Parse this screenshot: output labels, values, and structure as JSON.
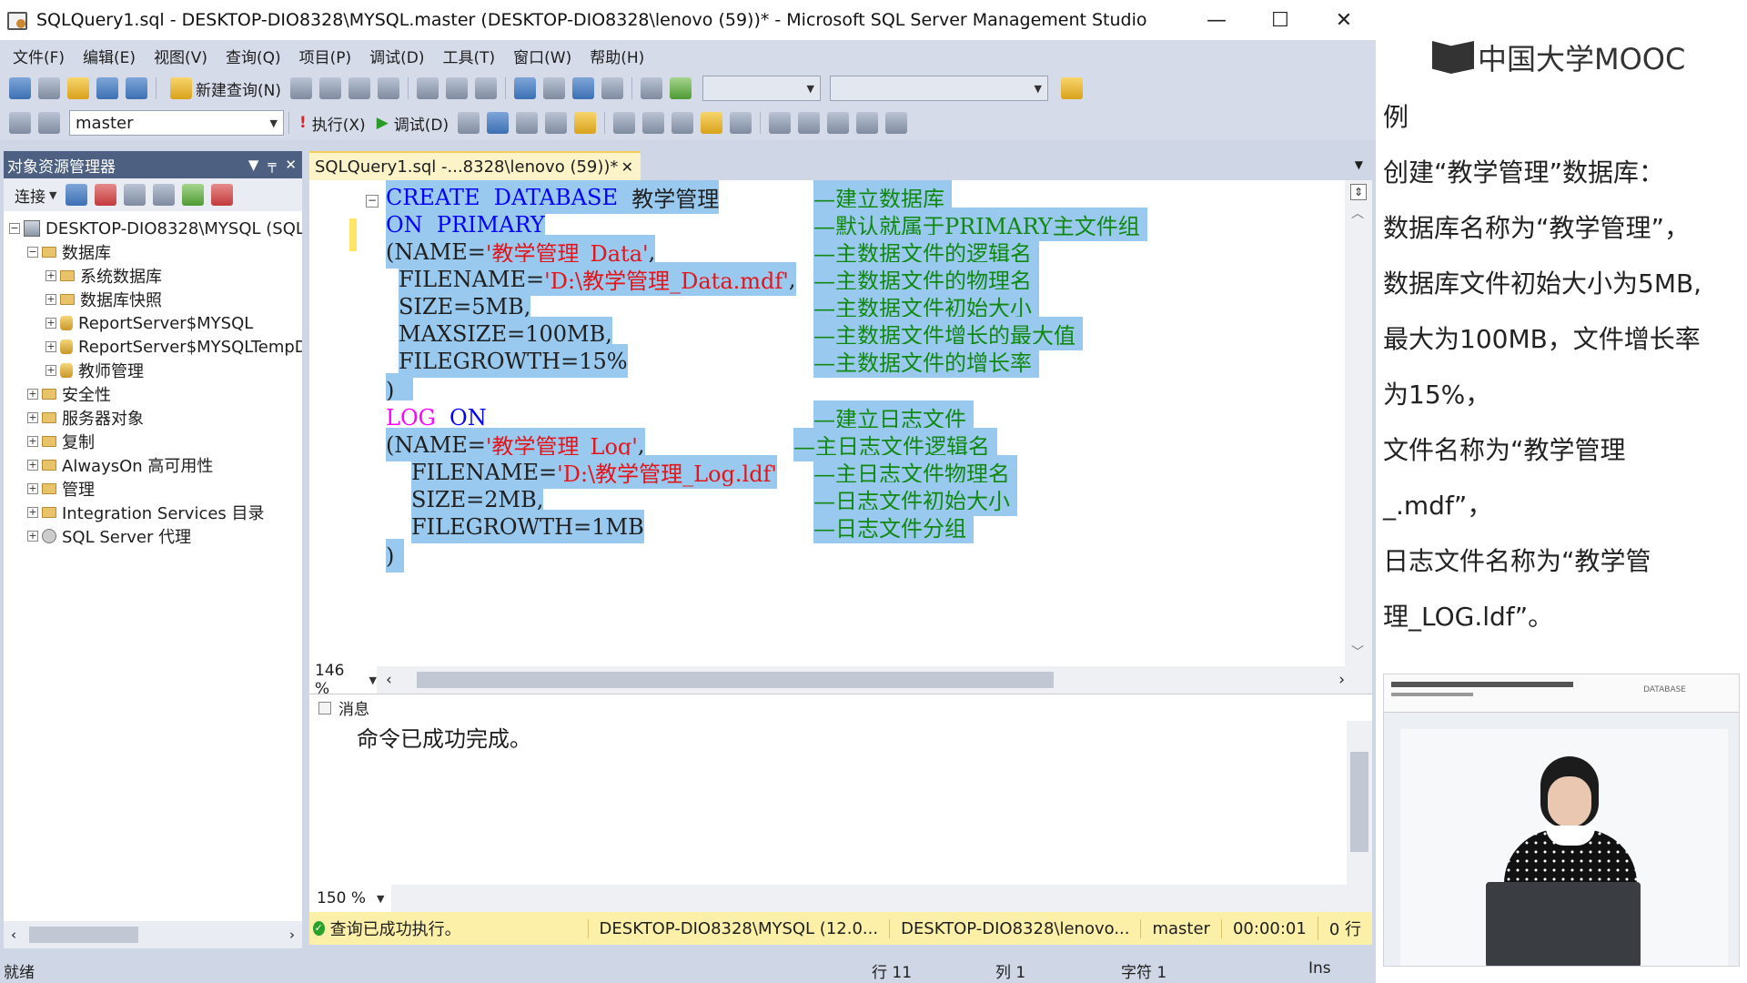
{
  "window": {
    "title": "SQLQuery1.sql - DESKTOP-DIO8328\\MYSQL.master (DESKTOP-DIO8328\\lenovo (59))* - Microsoft SQL Server Management Studio",
    "minimize": "—",
    "maximize": "☐",
    "close": "✕"
  },
  "menu": [
    "文件(F)",
    "编辑(E)",
    "视图(V)",
    "查询(Q)",
    "项目(P)",
    "调试(D)",
    "工具(T)",
    "窗口(W)",
    "帮助(H)"
  ],
  "toolbar": {
    "new_query": "新建查询(N)",
    "database": "master",
    "execute": "执行(X)",
    "debug": "调试(D)"
  },
  "object_explorer": {
    "title": "对象资源管理器",
    "connect": "连接",
    "server": "DESKTOP-DIO8328\\MYSQL (SQL",
    "nodes": {
      "databases": "数据库",
      "system_db": "系统数据库",
      "snapshots": "数据库快照",
      "rs": "ReportServer$MYSQL",
      "rs_temp": "ReportServer$MYSQLTempD",
      "teacher": "教师管理",
      "security": "安全性",
      "server_objects": "服务器对象",
      "replication": "复制",
      "alwayson": "AlwaysOn 高可用性",
      "management": "管理",
      "integration": "Integration Services 目录",
      "agent": "SQL Server 代理"
    }
  },
  "tab": {
    "label": "SQLQuery1.sql -...8328\\lenovo (59))*",
    "close": "✕"
  },
  "code": {
    "l1_k": "CREATE  DATABASE",
    "l1_n": "  教学管理",
    "l1_c": "—建立数据库",
    "l2_k": "ON  PRIMARY",
    "l2_c": "—默认就属于PRIMARY主文件组",
    "l3_a": "(NAME=",
    "l3_s": "'教学管理_Data'",
    "l3_b": ",",
    "l3_c": "—主数据文件的逻辑名",
    "l4_a": "FILENAME=",
    "l4_s": "'D:\\教学管理_Data.mdf'",
    "l4_b": ",",
    "l4_c": "—主数据文件的物理名",
    "l5_a": "SIZE=5MB,",
    "l5_c": "—主数据文件初始大小",
    "l6_a": "MAXSIZE=100MB,",
    "l6_c": "—主数据文件增长的最大值",
    "l7_a": "FILEGROWTH=15%",
    "l7_c": "—主数据文件的增长率",
    "l8_a": ")",
    "l9_k1": "LOG",
    "l9_k2": "  ON",
    "l9_c": "—建立日志文件",
    "l10_a": "(NAME=",
    "l10_s": "'教学管理_Log'",
    "l10_b": ",",
    "l10_c": "—主日志文件逻辑名",
    "l11_a": "FILENAME=",
    "l11_s": "'D:\\教学管理_Log.ldf'",
    "l11_c": "—主日志文件物理名",
    "l12_a": "SIZE=2MB,",
    "l12_c": "—日志文件初始大小",
    "l13_a": "FILEGROWTH=1MB",
    "l13_c": "—日志文件分组",
    "l14_a": ")"
  },
  "editor_zoom": "146 %",
  "results": {
    "tab": "消息",
    "message": "命令已成功完成。",
    "zoom": "150 %"
  },
  "query_status": {
    "text": "查询已成功执行。",
    "server": "DESKTOP-DIO8328\\MYSQL (12.0...",
    "user": "DESKTOP-DIO8328\\lenovo...",
    "db": "master",
    "time": "00:00:01",
    "rows": "0 行"
  },
  "app_status": {
    "ready": "就绪",
    "line": "行 11",
    "col": "列 1",
    "ch": "字符 1",
    "ins": "Ins"
  },
  "lesson": {
    "logo": "中国大学MOOC",
    "lines": [
      "例",
      "创建“教学管理”数据库：",
      "数据库名称为“教学管理”，",
      "数据库文件初始大小为5MB,",
      "最大为100MB，文件增长率",
      "为15%，",
      "文件名称为“教学管理",
      "_.mdf”，",
      "日志文件名称为“教学管",
      "理_LOG.ldf”。"
    ],
    "video_tag": "DATABASE"
  }
}
